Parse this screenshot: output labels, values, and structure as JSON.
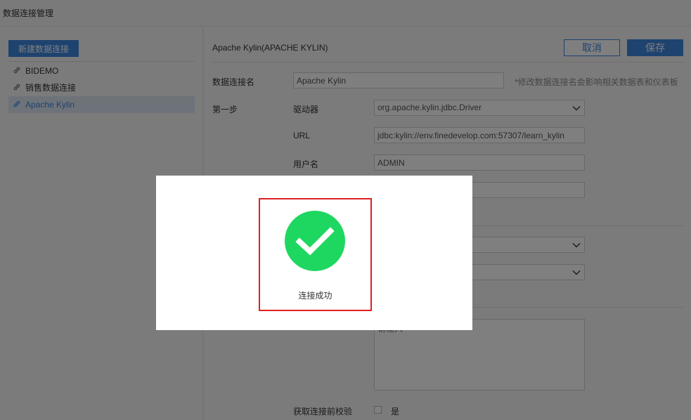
{
  "app": {
    "title": "数据连接管理"
  },
  "sidebar": {
    "new_button": "新建数据连接",
    "items": [
      {
        "label": "BIDEMO"
      },
      {
        "label": "销售数据连接"
      },
      {
        "label": "Apache Kylin",
        "active": true
      }
    ]
  },
  "main": {
    "title": "Apache Kylin(APACHE KYLIN)",
    "cancel": "取消",
    "save": "保存",
    "conn_name_label": "数据连接名",
    "conn_name_value": "Apache Kylin",
    "conn_name_hint": "*修改数据连接名会影响相关数据表和仪表板",
    "step_label": "第一步",
    "driver_label": "驱动器",
    "driver_value": "org.apache.kylin.jdbc.Driver",
    "url_label": "URL",
    "url_value": "jdbc:kylin://env.finedevelop.com:57307/learn_kylin",
    "user_label": "用户名",
    "user_value": "ADMIN",
    "textarea_placeholder": "请输入",
    "validate_label": "获取连接前校验",
    "validate_option": "是"
  },
  "dialog": {
    "message": "连接成功"
  },
  "colors": {
    "accent": "#3d86dc",
    "success": "#1ed760",
    "highlight": "#e02020"
  }
}
